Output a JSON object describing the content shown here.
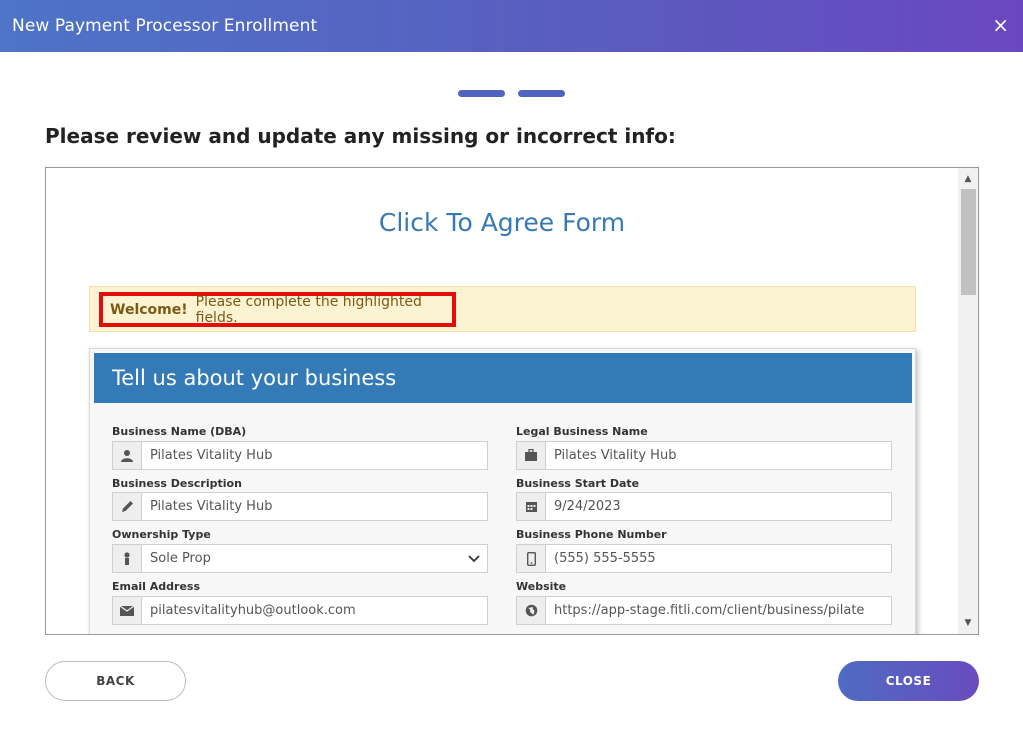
{
  "header": {
    "title": "New Payment Processor Enrollment",
    "close_glyph": "×"
  },
  "prompt": "Please review and update any missing or incorrect info:",
  "form": {
    "title": "Click To Agree Form",
    "alert": {
      "strong": "Welcome!",
      "text": "Please complete the highlighted fields."
    },
    "section_title": "Tell us about your business",
    "fields": {
      "business_name": {
        "label": "Business Name (DBA)",
        "value": "Pilates Vitality Hub",
        "icon": "user-icon"
      },
      "legal_name": {
        "label": "Legal Business Name",
        "value": "Pilates Vitality Hub",
        "icon": "briefcase-icon"
      },
      "description": {
        "label": "Business Description",
        "value": "Pilates Vitality Hub",
        "icon": "pencil-icon"
      },
      "start_date": {
        "label": "Business Start Date",
        "value": "9/24/2023",
        "icon": "calendar-icon"
      },
      "ownership": {
        "label": "Ownership Type",
        "value": "Sole Prop",
        "icon": "person-icon"
      },
      "phone": {
        "label": "Business Phone Number",
        "value": "(555) 555-5555",
        "icon": "phone-icon"
      },
      "email": {
        "label": "Email Address",
        "value": "pilatesvitalityhub@outlook.com",
        "icon": "envelope-icon"
      },
      "website": {
        "label": "Website",
        "value": "https://app-stage.fitli.com/client/business/pilate",
        "icon": "globe-icon"
      }
    }
  },
  "footer": {
    "back_label": "BACK",
    "close_label": "CLOSE"
  },
  "colors": {
    "accent": "#5a5bbf",
    "panel_header": "#337ab7",
    "alert_border": "#e30d0d"
  }
}
